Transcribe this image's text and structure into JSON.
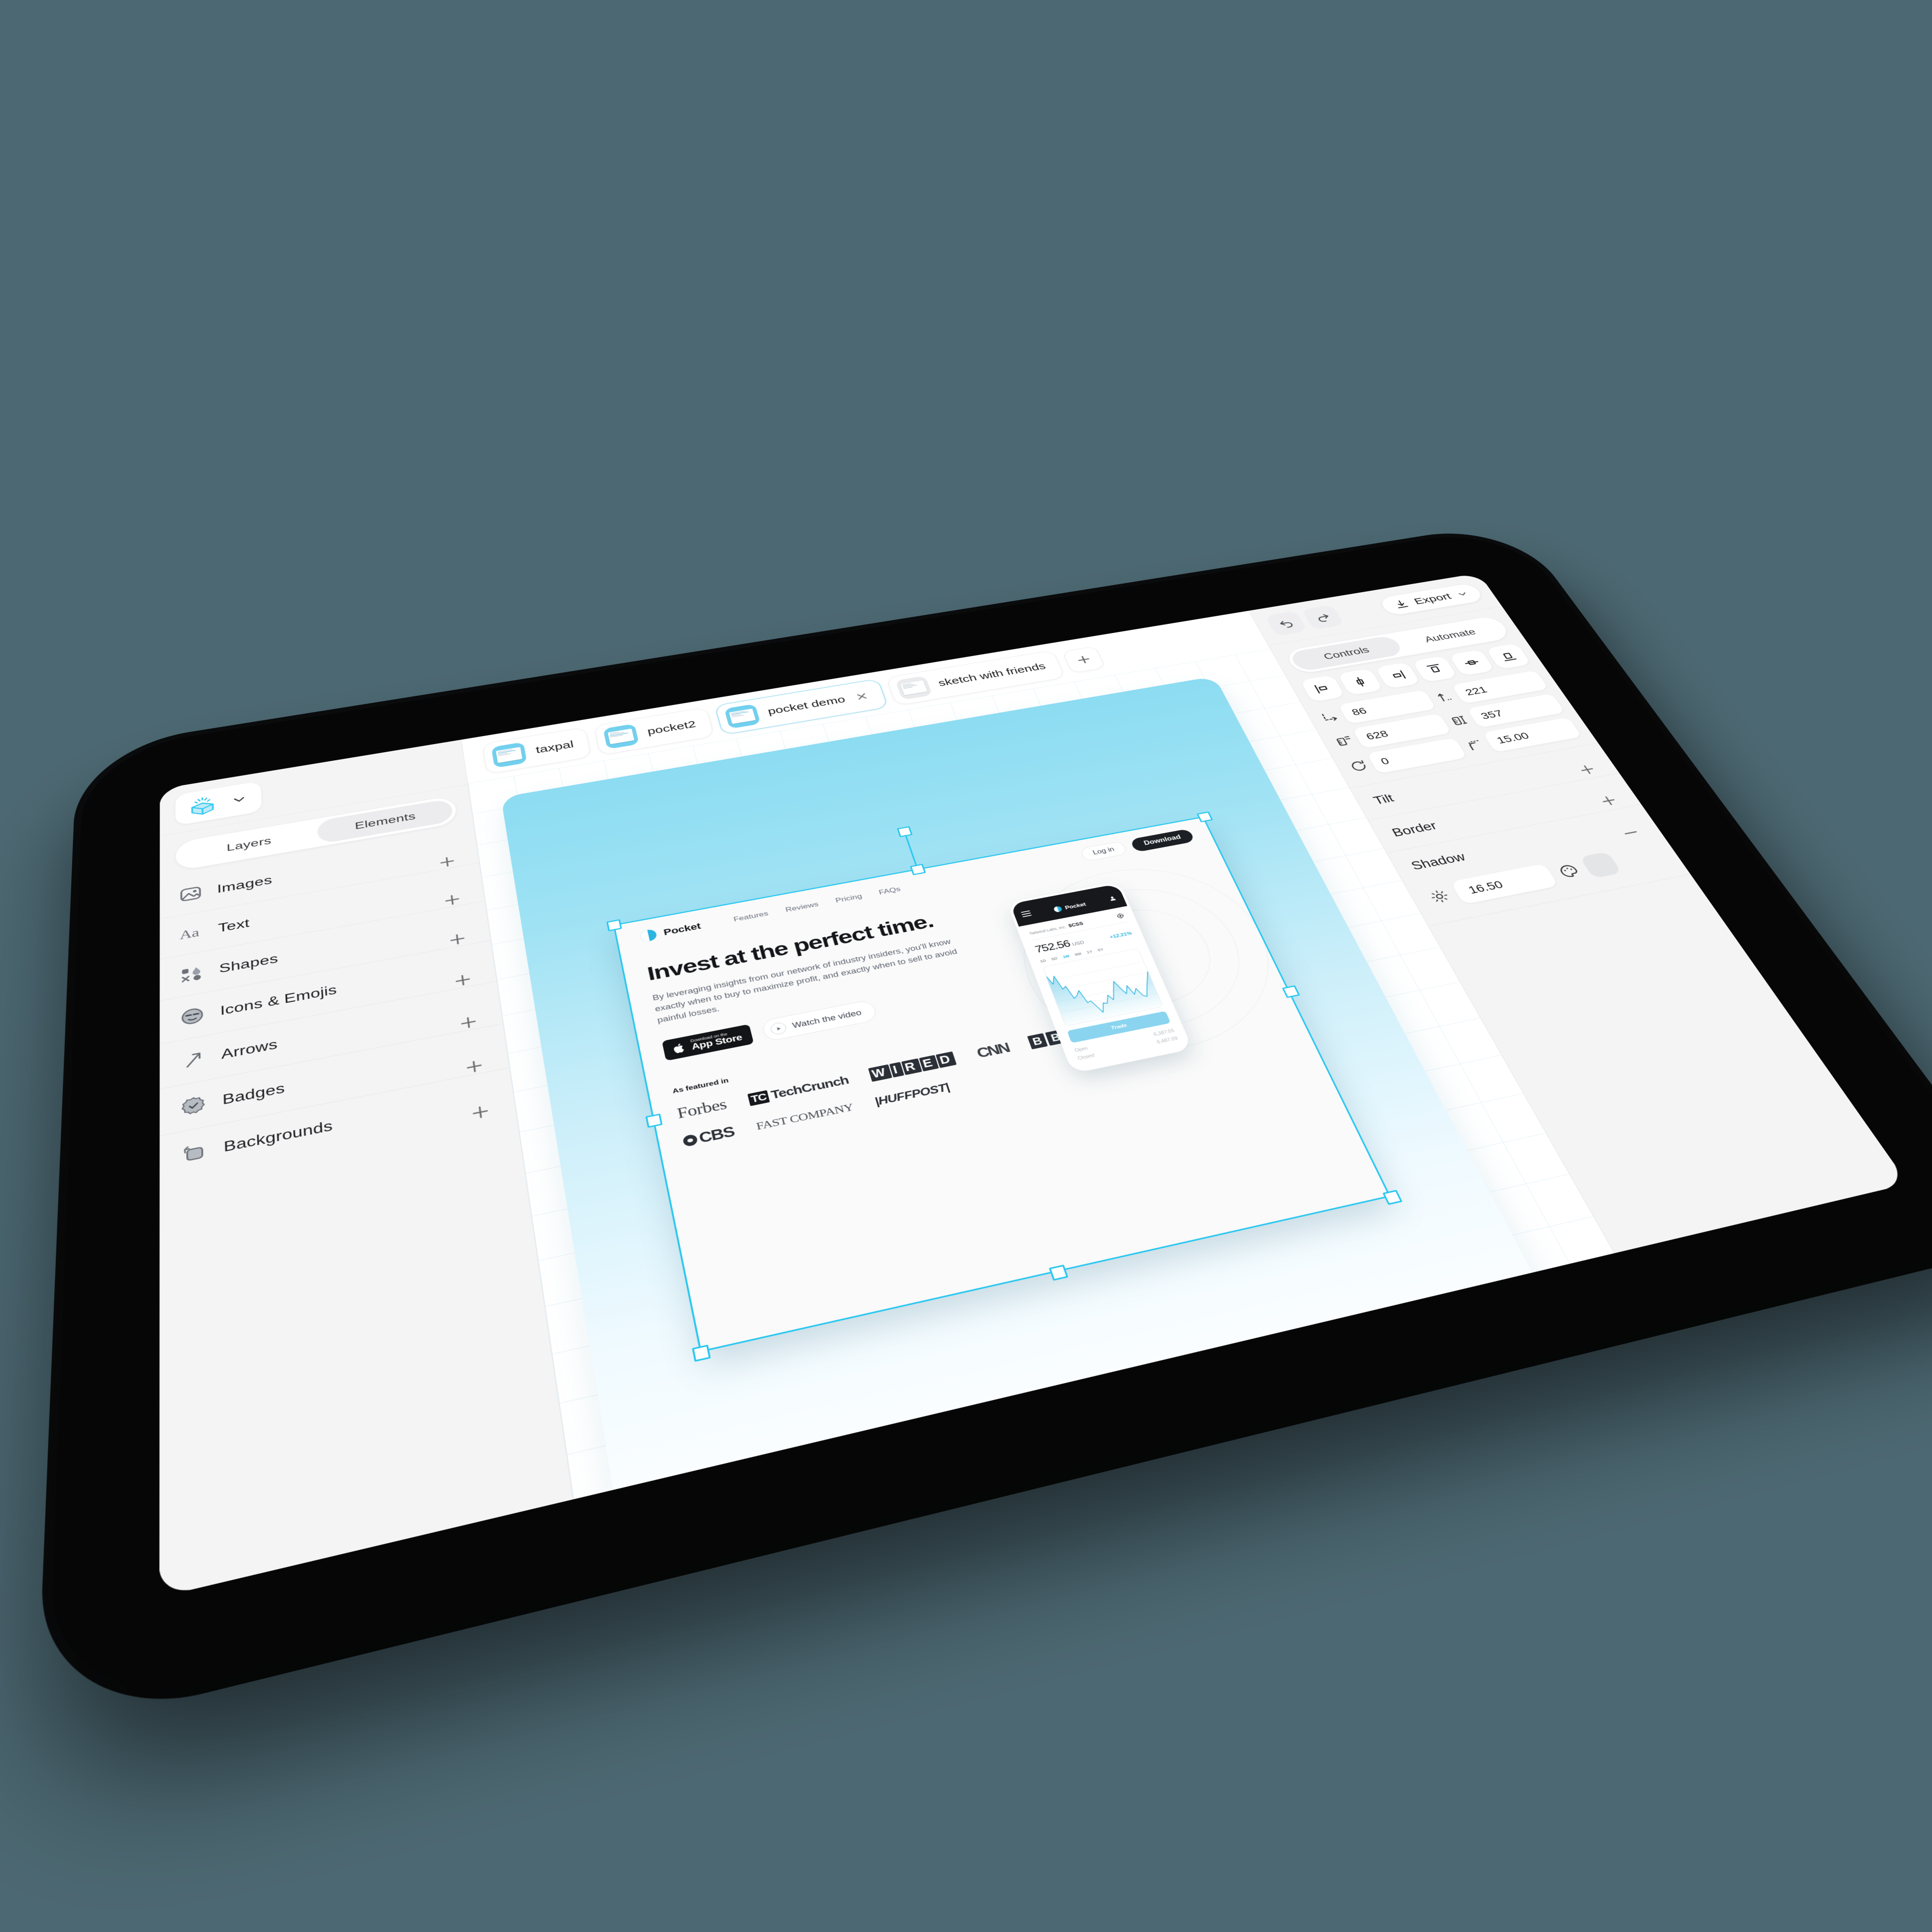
{
  "app": {
    "brand_icon": "cube-logo-icon",
    "brand_chevron": "chevron-down-icon"
  },
  "sidebar": {
    "tabs": [
      {
        "label": "Layers",
        "active": false
      },
      {
        "label": "Elements",
        "active": true
      }
    ],
    "categories": [
      {
        "label": "Images",
        "icon": "image-icon",
        "add": "+"
      },
      {
        "label": "Text",
        "icon": "text-aa-icon",
        "add": "+"
      },
      {
        "label": "Shapes",
        "icon": "shapes-icon",
        "add": "+"
      },
      {
        "label": "Icons & Emojis",
        "icon": "emoji-icon",
        "add": "+"
      },
      {
        "label": "Arrows",
        "icon": "arrow-icon",
        "add": "+"
      },
      {
        "label": "Badges",
        "icon": "badge-icon",
        "add": "+"
      },
      {
        "label": "Backgrounds",
        "icon": "background-icon",
        "add": "+"
      }
    ]
  },
  "tabbar": {
    "tabs": [
      {
        "label": "taxpal",
        "active": false,
        "closable": false
      },
      {
        "label": "pocket2",
        "active": false,
        "closable": false
      },
      {
        "label": "pocket demo",
        "active": true,
        "closable": true
      },
      {
        "label": "sketch with friends",
        "active": false,
        "closable": false
      }
    ],
    "add_tab_icon": "plus-icon"
  },
  "right_panel": {
    "undo_icon": "undo-icon",
    "redo_icon": "redo-icon",
    "export_label": "Export",
    "export_icon": "download-icon",
    "export_chevron": "chevron-down-icon",
    "tabs": [
      {
        "label": "Controls",
        "active": true
      },
      {
        "label": "Automate",
        "active": false
      }
    ],
    "align_buttons": [
      "align-left-icon",
      "align-center-horizontal-icon",
      "align-right-icon",
      "align-top-icon",
      "align-middle-vertical-icon",
      "align-bottom-icon"
    ],
    "fields": [
      {
        "icon": "position-x-icon",
        "value": "86"
      },
      {
        "icon": "position-y-icon",
        "value": "221"
      },
      {
        "icon": "width-icon",
        "value": "628"
      },
      {
        "icon": "height-icon",
        "value": "357"
      },
      {
        "icon": "rotation-icon",
        "value": "0"
      },
      {
        "icon": "corner-radius-icon",
        "value": "15.00"
      }
    ],
    "sections": [
      {
        "label": "Tilt",
        "toggle": "+"
      },
      {
        "label": "Border",
        "toggle": "+"
      },
      {
        "label": "Shadow",
        "toggle": "–"
      }
    ],
    "shadow": {
      "icon": "brightness-icon",
      "value": "16.50",
      "palette_icon": "palette-icon",
      "swatch_color": "#e4e5e7"
    }
  },
  "canvas": {
    "artboard_gradient_from": "#8cdcf2",
    "artboard_gradient_to": "#ffffff",
    "selection_color": "#29c7f0",
    "mockup": {
      "nav": {
        "brand": "Pocket",
        "links": [
          "Features",
          "Reviews",
          "Pricing",
          "FAQs"
        ],
        "login_label": "Log in",
        "download_label": "Download"
      },
      "hero": {
        "headline": "Invest at the perfect time.",
        "paragraph": "By leveraging insights from our network of industry insiders, you'll know exactly when to buy to maximize profit, and exactly when to sell to avoid painful losses.",
        "appstore_small": "Download on the",
        "appstore_big": "App Store",
        "watch_label": "Watch the video"
      },
      "featured": {
        "title": "As featured in",
        "logos": [
          "Forbes",
          "TechCrunch",
          "WIRED",
          "CNN",
          "BBC",
          "CBS",
          "FAST COMPANY",
          "HUFFPOST"
        ]
      },
      "phone": {
        "brand": "Pocket",
        "company": "Tailwind Labs, Inc.",
        "ticker": "$CSS",
        "price": "752.56",
        "currency": "USD",
        "change": "+12.21%",
        "timeframes": [
          "1D",
          "5D",
          "1M",
          "6M",
          "1Y",
          "5Y"
        ],
        "active_timeframe": "1M",
        "trade_label": "Trade",
        "stats": [
          {
            "label": "Open",
            "value": "6,387.55"
          },
          {
            "label": "Closed",
            "value": "6,487.09"
          }
        ]
      }
    }
  },
  "chart_data": {
    "type": "line",
    "title": "Tailwind Labs, Inc. $CSS — 1M",
    "ylabel": "USD",
    "xlabel": "",
    "values": [
      88,
      72,
      86,
      60,
      64,
      40,
      44,
      52,
      28,
      30,
      18,
      6,
      22,
      20,
      34,
      24,
      40,
      56,
      42,
      30,
      44,
      26,
      36,
      22,
      18,
      34,
      48,
      62
    ],
    "ylim": [
      0,
      100
    ],
    "grid": true,
    "legend": "none",
    "series_color": "#2bb5e0",
    "fill": true
  }
}
